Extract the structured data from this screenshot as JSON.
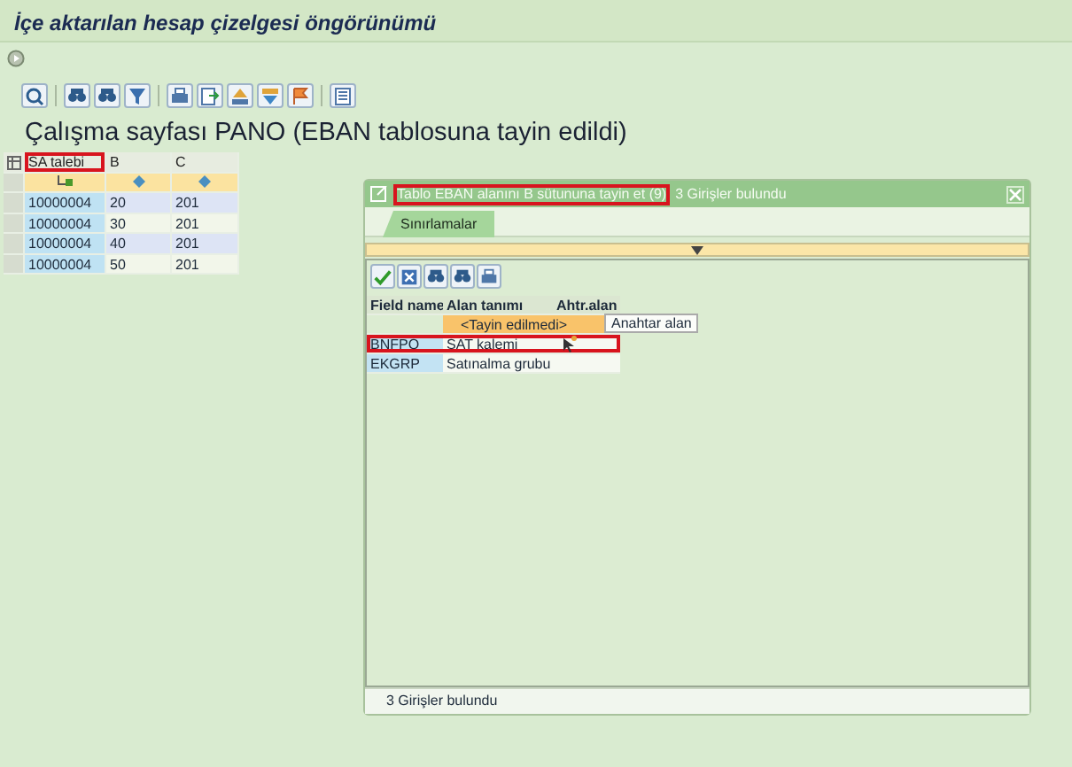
{
  "window": {
    "title": "İçe aktarılan hesap çizelgesi öngörünümü"
  },
  "worksheet": {
    "heading": "Çalışma sayfası PANO (EBAN tablosuna tayin edildi)",
    "columns": [
      {
        "label": "SA talebi",
        "highlighted": true
      },
      {
        "label": "B",
        "highlighted": false
      },
      {
        "label": "C",
        "highlighted": false
      }
    ],
    "rows": [
      [
        "10000004",
        "20",
        "201"
      ],
      [
        "10000004",
        "30",
        "201"
      ],
      [
        "10000004",
        "40",
        "201"
      ],
      [
        "10000004",
        "50",
        "201"
      ]
    ]
  },
  "dialog": {
    "title": "Tablo EBAN alanını B sütununa tayin et (9)",
    "title_highlighted": true,
    "title_note": "3 Girişler bulundu",
    "tabs": [
      {
        "label": "Sınırlamalar",
        "selected": true
      }
    ],
    "columns": [
      "Field name",
      "Alan tanımı",
      "Ahtr.alan"
    ],
    "rows": [
      {
        "kind": "unassigned",
        "description": "<Tayin edilmedi>",
        "highlighted": false
      },
      {
        "kind": "field",
        "field_name": "BNFPO",
        "description": "SAT kalemi",
        "highlighted": true
      },
      {
        "kind": "field",
        "field_name": "EKGRP",
        "description": "Satınalma grubu",
        "highlighted": false
      }
    ],
    "tooltip": "Anahtar alan",
    "status": "3 Girişler bulundu"
  }
}
